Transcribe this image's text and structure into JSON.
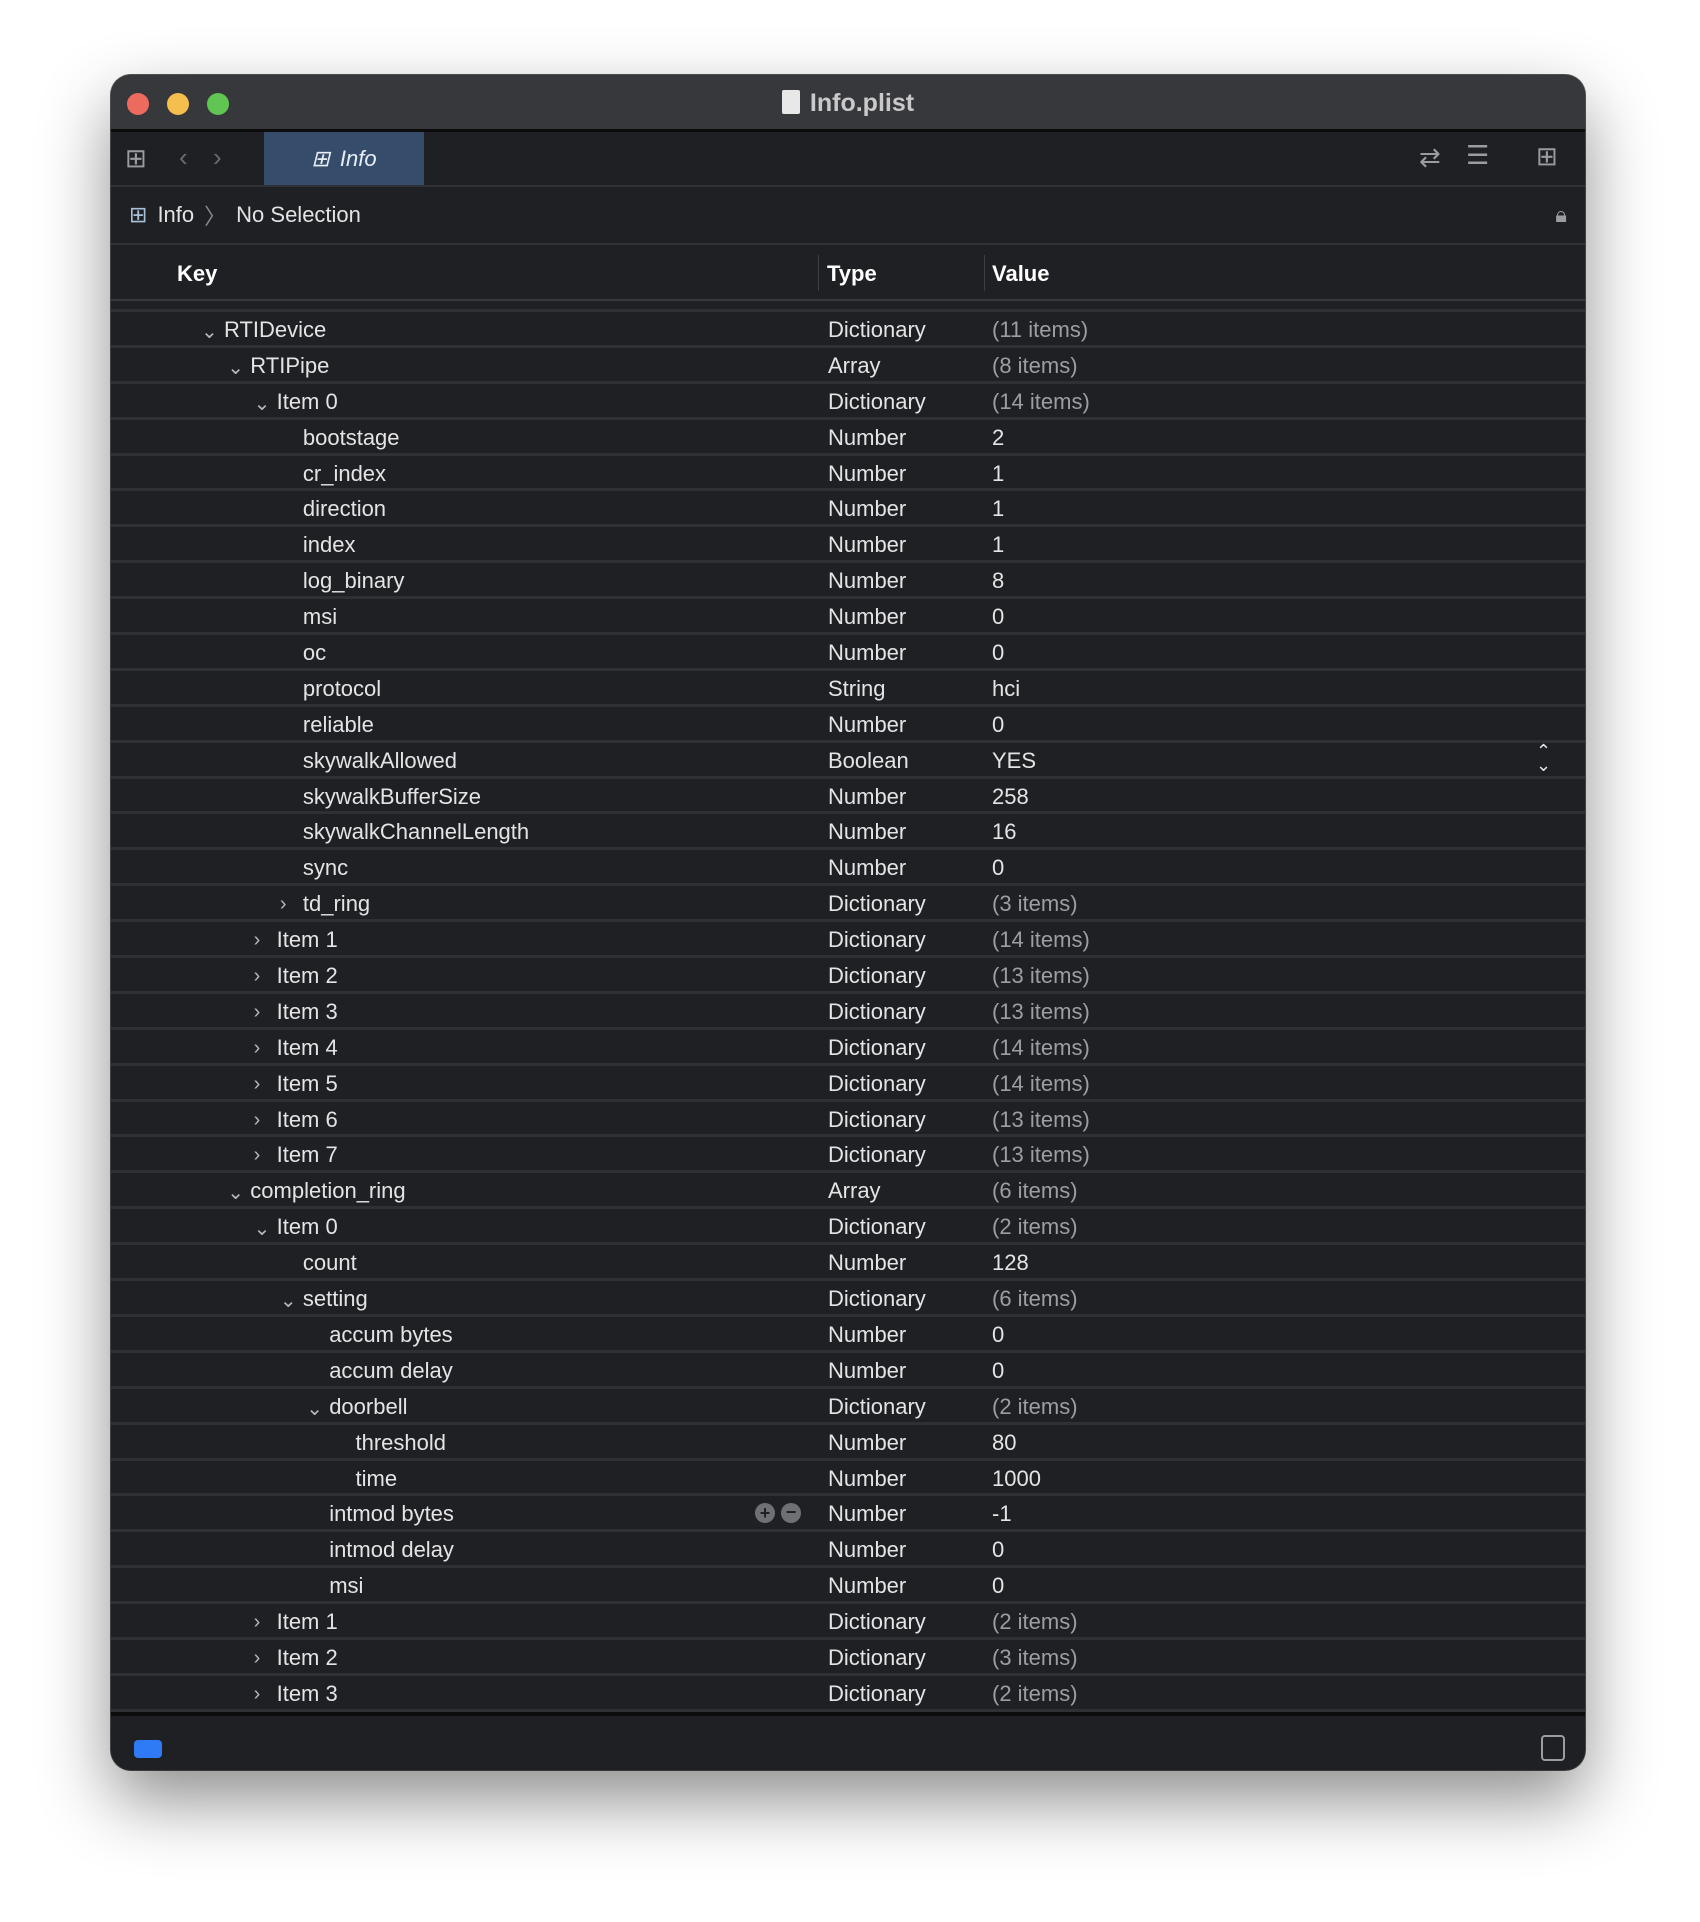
{
  "window": {
    "title": "Info.plist",
    "traffic_colors": [
      "#ed6a5e",
      "#f5bf4f",
      "#61c554"
    ]
  },
  "toolbar": {
    "tab_label": "Info",
    "accent": "#364c6b"
  },
  "breadcrumb": {
    "root": "Info",
    "current": "No Selection"
  },
  "columns": {
    "key": "Key",
    "type": "Type",
    "value": "Value"
  },
  "rows": [
    {
      "key": "RTIDevice",
      "type": "Dictionary",
      "value": "(11 items)",
      "level": 1,
      "disclosure": "open"
    },
    {
      "key": "RTIPipe",
      "type": "Array",
      "value": "(8 items)",
      "level": 2,
      "disclosure": "open"
    },
    {
      "key": "Item 0",
      "type": "Dictionary",
      "value": "(14 items)",
      "level": 3,
      "disclosure": "open"
    },
    {
      "key": "bootstage",
      "type": "Number",
      "value": "2",
      "level": 4
    },
    {
      "key": "cr_index",
      "type": "Number",
      "value": "1",
      "level": 4
    },
    {
      "key": "direction",
      "type": "Number",
      "value": "1",
      "level": 4
    },
    {
      "key": "index",
      "type": "Number",
      "value": "1",
      "level": 4
    },
    {
      "key": "log_binary",
      "type": "Number",
      "value": "8",
      "level": 4
    },
    {
      "key": "msi",
      "type": "Number",
      "value": "0",
      "level": 4
    },
    {
      "key": "oc",
      "type": "Number",
      "value": "0",
      "level": 4
    },
    {
      "key": "protocol",
      "type": "String",
      "value": "hci",
      "level": 4
    },
    {
      "key": "reliable",
      "type": "Number",
      "value": "0",
      "level": 4
    },
    {
      "key": "skywalkAllowed",
      "type": "Boolean",
      "value": "YES",
      "level": 4,
      "stepper": true
    },
    {
      "key": "skywalkBufferSize",
      "type": "Number",
      "value": "258",
      "level": 4
    },
    {
      "key": "skywalkChannelLength",
      "type": "Number",
      "value": "16",
      "level": 4
    },
    {
      "key": "sync",
      "type": "Number",
      "value": "0",
      "level": 4
    },
    {
      "key": "td_ring",
      "type": "Dictionary",
      "value": "(3 items)",
      "level": 4,
      "disclosure": "closed"
    },
    {
      "key": "Item 1",
      "type": "Dictionary",
      "value": "(14 items)",
      "level": 3,
      "disclosure": "closed"
    },
    {
      "key": "Item 2",
      "type": "Dictionary",
      "value": "(13 items)",
      "level": 3,
      "disclosure": "closed"
    },
    {
      "key": "Item 3",
      "type": "Dictionary",
      "value": "(13 items)",
      "level": 3,
      "disclosure": "closed"
    },
    {
      "key": "Item 4",
      "type": "Dictionary",
      "value": "(14 items)",
      "level": 3,
      "disclosure": "closed"
    },
    {
      "key": "Item 5",
      "type": "Dictionary",
      "value": "(14 items)",
      "level": 3,
      "disclosure": "closed"
    },
    {
      "key": "Item 6",
      "type": "Dictionary",
      "value": "(13 items)",
      "level": 3,
      "disclosure": "closed"
    },
    {
      "key": "Item 7",
      "type": "Dictionary",
      "value": "(13 items)",
      "level": 3,
      "disclosure": "closed"
    },
    {
      "key": "completion_ring",
      "type": "Array",
      "value": "(6 items)",
      "level": 2,
      "disclosure": "open"
    },
    {
      "key": "Item 0",
      "type": "Dictionary",
      "value": "(2 items)",
      "level": 3,
      "disclosure": "open"
    },
    {
      "key": "count",
      "type": "Number",
      "value": "128",
      "level": 4
    },
    {
      "key": "setting",
      "type": "Dictionary",
      "value": "(6 items)",
      "level": 4,
      "disclosure": "open"
    },
    {
      "key": "accum bytes",
      "type": "Number",
      "value": "0",
      "level": 5
    },
    {
      "key": "accum delay",
      "type": "Number",
      "value": "0",
      "level": 5
    },
    {
      "key": "doorbell",
      "type": "Dictionary",
      "value": "(2 items)",
      "level": 5,
      "disclosure": "open"
    },
    {
      "key": "threshold",
      "type": "Number",
      "value": "80",
      "level": 6
    },
    {
      "key": "time",
      "type": "Number",
      "value": "1000",
      "level": 6
    },
    {
      "key": "intmod bytes",
      "type": "Number",
      "value": "-1",
      "level": 5,
      "add_remove": true
    },
    {
      "key": "intmod delay",
      "type": "Number",
      "value": "0",
      "level": 5
    },
    {
      "key": "msi",
      "type": "Number",
      "value": "0",
      "level": 5
    },
    {
      "key": "Item 1",
      "type": "Dictionary",
      "value": "(2 items)",
      "level": 3,
      "disclosure": "closed"
    },
    {
      "key": "Item 2",
      "type": "Dictionary",
      "value": "(3 items)",
      "level": 3,
      "disclosure": "closed"
    },
    {
      "key": "Item 3",
      "type": "Dictionary",
      "value": "(2 items)",
      "level": 3,
      "disclosure": "closed"
    }
  ]
}
